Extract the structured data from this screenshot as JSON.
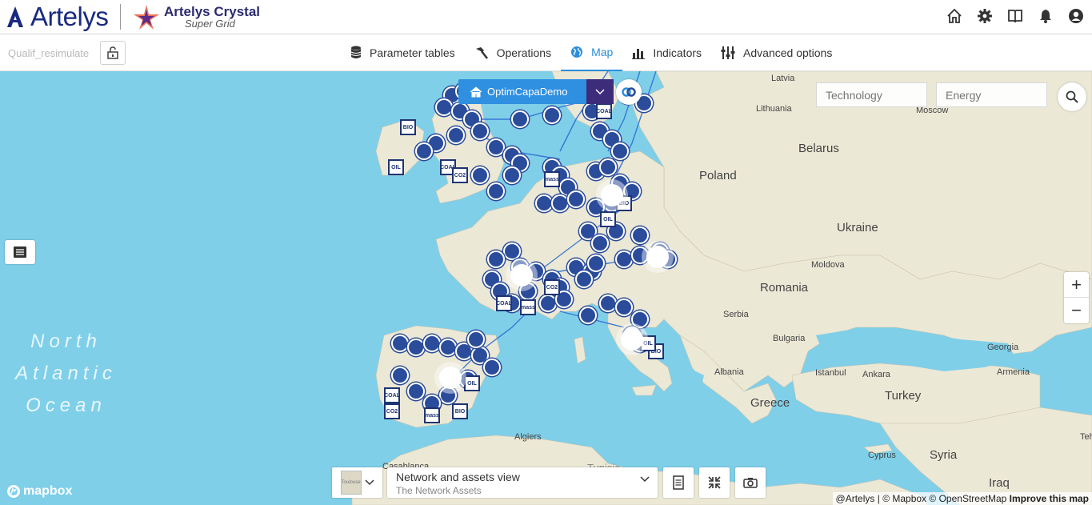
{
  "brand": {
    "logo_text": "Artelys",
    "product_name": "Artelys Crystal",
    "product_sub": "Super Grid"
  },
  "top_icons": [
    "home-icon",
    "gear-icon",
    "book-icon",
    "bell-icon",
    "user-icon"
  ],
  "navbar": {
    "scenario_name": "Qualif_resimulate",
    "tabs": [
      {
        "label": "Parameter tables",
        "icon": "database-icon"
      },
      {
        "label": "Operations",
        "icon": "hammer-icon"
      },
      {
        "label": "Map",
        "icon": "globe-icon",
        "active": true
      },
      {
        "label": "Indicators",
        "icon": "bar-chart-icon"
      },
      {
        "label": "Advanced options",
        "icon": "sliders-icon"
      }
    ]
  },
  "map": {
    "scenario_button": "OptimCapaDemo",
    "filters": {
      "technology_placeholder": "Technology",
      "energy_placeholder": "Energy"
    },
    "labels": {
      "latvia": "Latvia",
      "lithuania": "Lithuania",
      "moscow": "Moscow",
      "belarus": "Belarus",
      "poland": "Poland",
      "ukraine": "Ukraine",
      "moldova": "Moldova",
      "romania": "Romania",
      "serbia": "Serbia",
      "bulgaria": "Bulgaria",
      "georgia": "Georgia",
      "armenia": "Armenia",
      "albania": "Albania",
      "istanbul": "Istanbul",
      "ankara": "Ankara",
      "turkey": "Turkey",
      "greece": "Greece",
      "cyprus": "Cyprus",
      "syria": "Syria",
      "iraq": "Iraq",
      "algiers": "Algiers",
      "tunisia": "Tunisia",
      "casablanca": "Casablanca",
      "teh": "Teh",
      "ocean_line1": "North",
      "ocean_line2": "Atlantic",
      "ocean_line3": "Ocean"
    },
    "asset_tags": [
      "BIO",
      "OIL",
      "COAL",
      "CO2",
      "mass"
    ],
    "zoom_in": "+",
    "zoom_out": "−",
    "view_select": {
      "title": "Network and assets view",
      "subtitle": "The Network Assets"
    },
    "thumbnail_label": "Toulouse",
    "attribution": {
      "artelys": "@Artelys",
      "mapbox": "© Mapbox",
      "osm": "© OpenStreetMap",
      "improve": "Improve this map"
    },
    "mapbox_logo": "mapbox"
  }
}
